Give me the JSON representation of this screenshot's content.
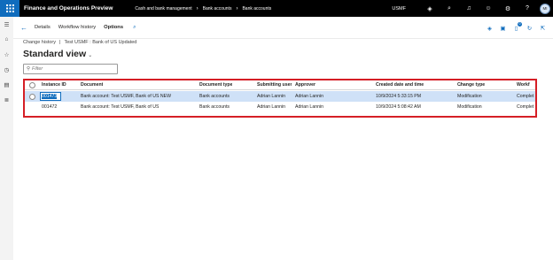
{
  "topbar": {
    "app_title": "Finance and Operations Preview",
    "breadcrumbs": [
      "Cash and bank management",
      "Bank accounts",
      "Bank accounts"
    ],
    "company": "USMF",
    "avatar_initials": "MI",
    "icons": [
      "waffle-icon",
      "copilot-icon",
      "search-icon",
      "bell-icon",
      "smiley-icon",
      "gear-icon",
      "help-icon"
    ]
  },
  "rail": {
    "icons": [
      "hamburger-icon",
      "home-icon",
      "star-icon",
      "clock-icon",
      "modules-icon",
      "list-icon"
    ]
  },
  "actionbar": {
    "tabs": [
      {
        "label": "Details",
        "active": false
      },
      {
        "label": "Workflow history",
        "active": false
      },
      {
        "label": "Options",
        "active": true
      }
    ],
    "right_icons": [
      "diamond-icon",
      "office-icon",
      "attachments-icon",
      "refresh-icon",
      "open-new-icon"
    ],
    "attachment_badge": "0"
  },
  "caption": {
    "left": "Change history",
    "right": "Test USMF : Bank of US Updated"
  },
  "view": {
    "title": "Standard view"
  },
  "filter": {
    "placeholder": "Filter"
  },
  "grid": {
    "columns": [
      "Instance ID",
      "Document",
      "Document type",
      "Submitting user",
      "Approver",
      "Created date and time",
      "Change type",
      "Workf"
    ],
    "rows": [
      {
        "instance_id": "001473",
        "document": "Bank account: Test USMF, Bank of US NEW",
        "document_type": "Bank accounts",
        "submitting_user": "Adrian Lannin",
        "approver": "Adrian Lannin",
        "created": "10/9/2024 5:33:15 PM",
        "change_type": "Modification",
        "workflow": "Complet"
      },
      {
        "instance_id": "001472",
        "document": "Bank account: Test USMF, Bank of US",
        "document_type": "Bank accounts",
        "submitting_user": "Adrian Lannin",
        "approver": "Adrian Lannin",
        "created": "10/9/2024 5:08:42 AM",
        "change_type": "Modification",
        "workflow": "Complet"
      }
    ]
  },
  "colors": {
    "brand": "#0f6cbd",
    "highlight_border": "#d51f26",
    "selected_row": "#cfe1f7"
  }
}
